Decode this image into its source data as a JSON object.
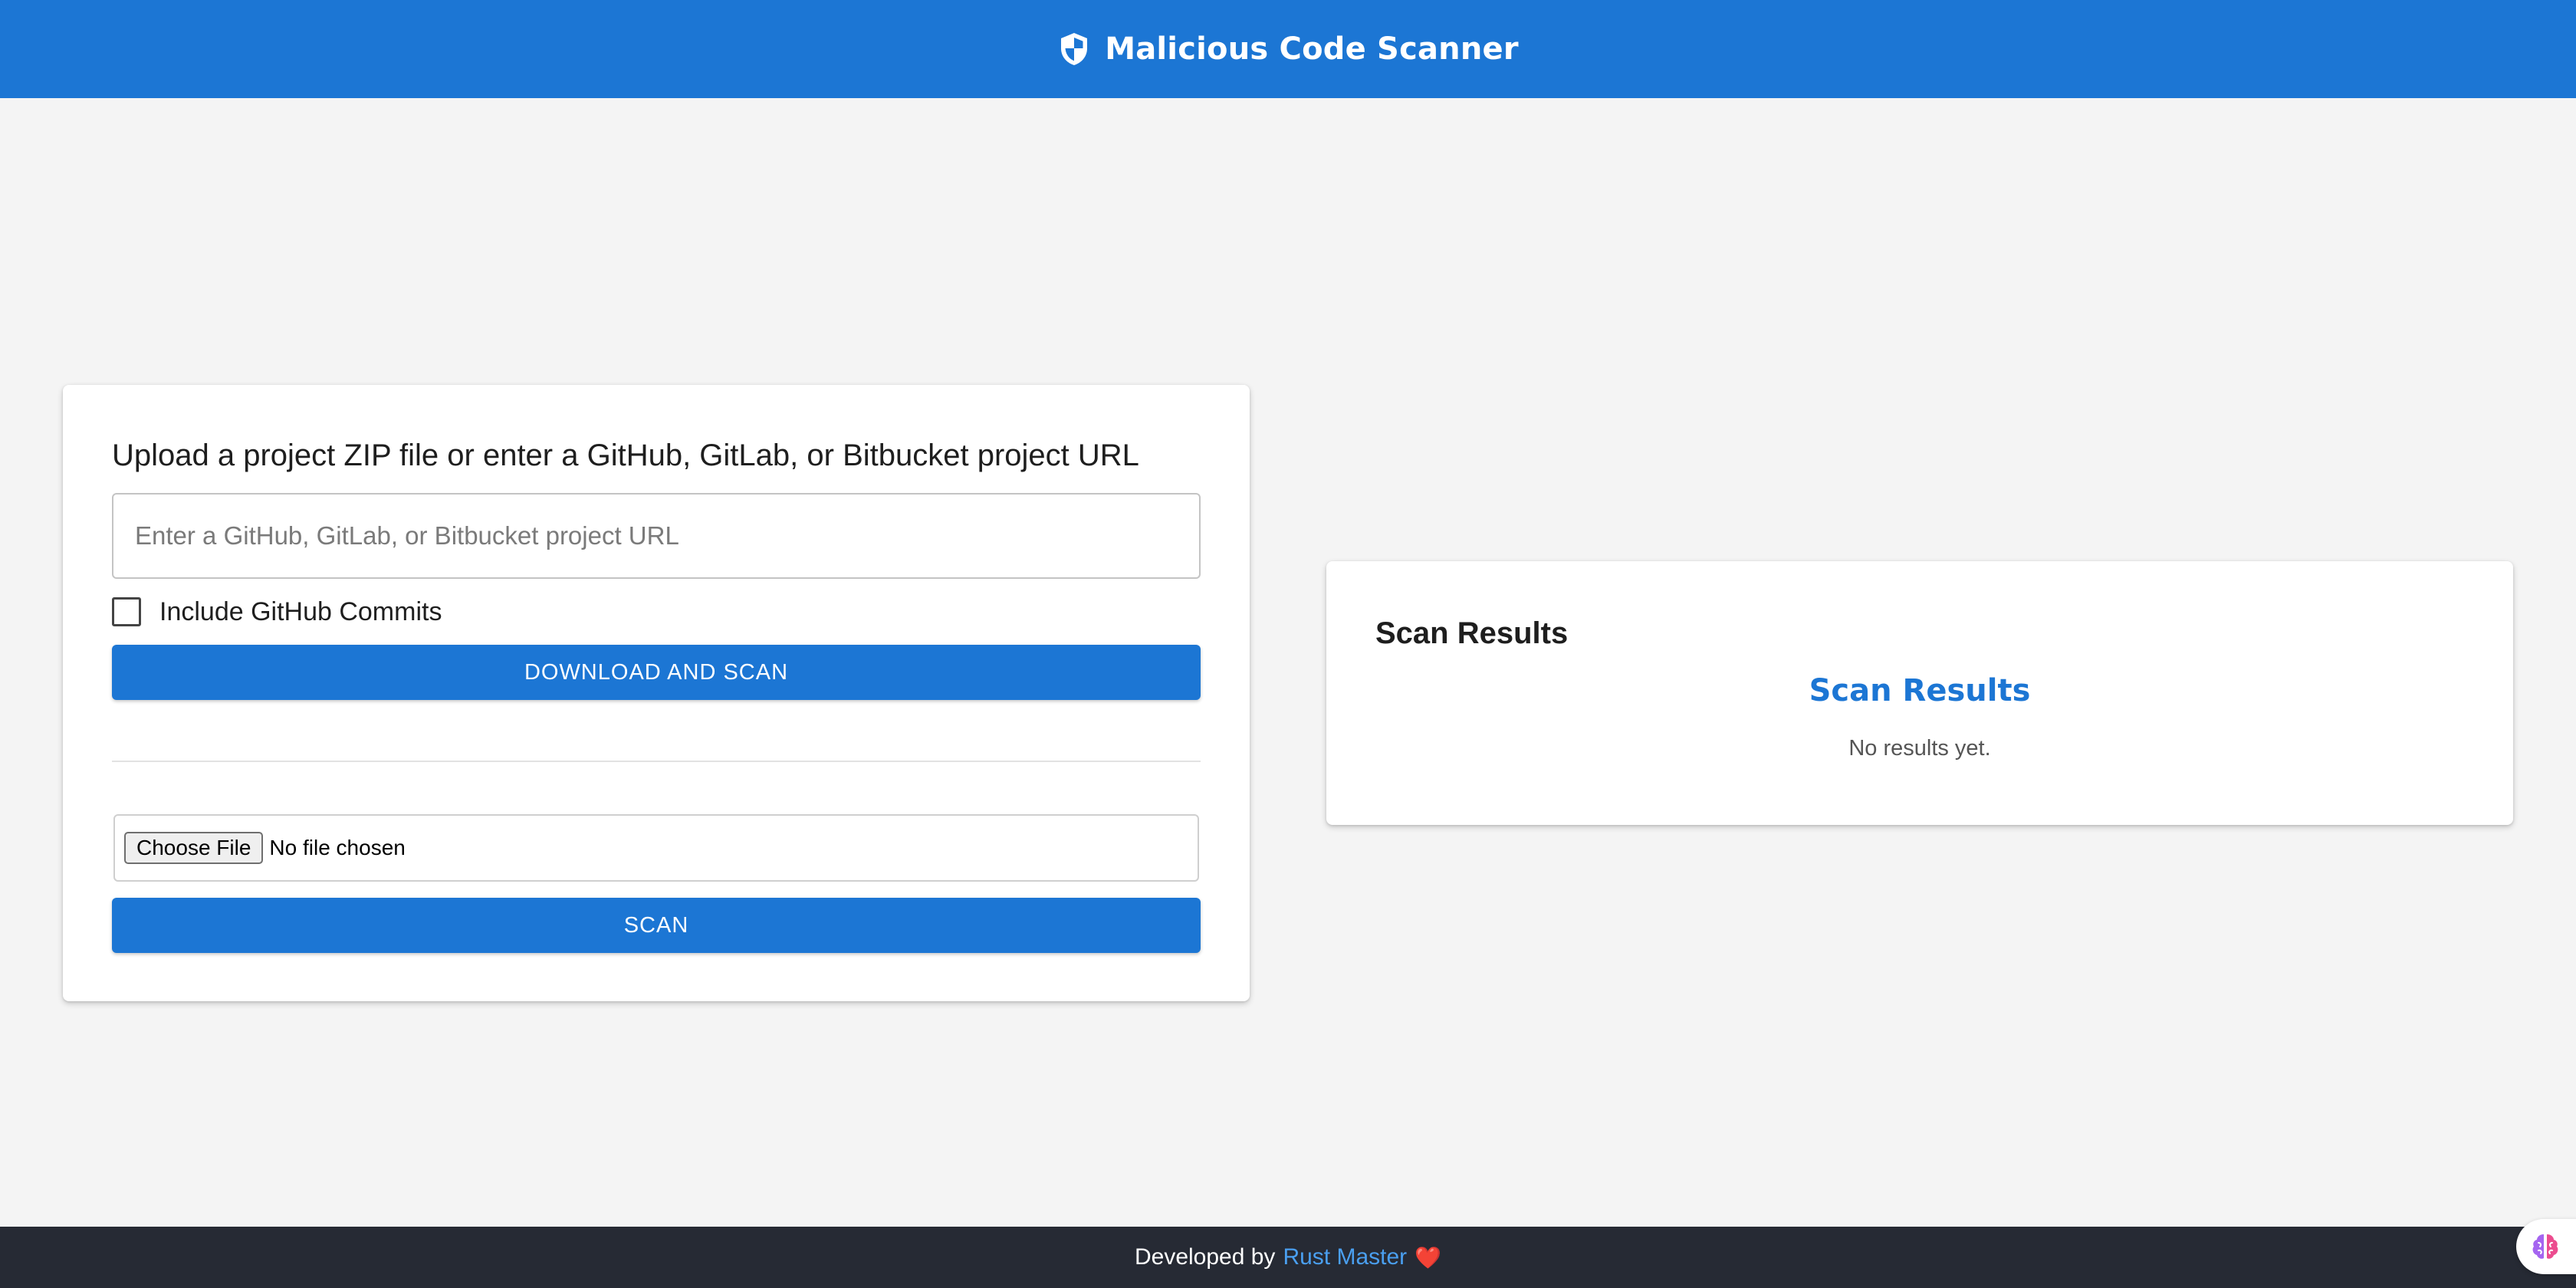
{
  "header": {
    "title": "Malicious Code Scanner",
    "icon": "shield-icon",
    "background": "#1c76d4"
  },
  "upload": {
    "heading": "Upload a project ZIP file or enter a GitHub, GitLab, or Bitbucket project URL",
    "url_placeholder": "Enter a GitHub, GitLab, or Bitbucket project URL",
    "url_value": "",
    "include_commits_label": "Include GitHub Commits",
    "include_commits_checked": false,
    "download_button": "DOWNLOAD AND SCAN",
    "choose_file_button": "Choose File",
    "file_status": "No file chosen",
    "scan_button": "SCAN"
  },
  "results": {
    "heading": "Scan Results",
    "subheading": "Scan Results",
    "empty_message": "No results yet."
  },
  "footer": {
    "prefix": "Developed by",
    "author": "Rust Master",
    "heart": "❤️",
    "background": "#262a34"
  },
  "widget": {
    "icon": "brain-icon"
  },
  "colors": {
    "primary": "#1c76d4",
    "page_background": "#f4f4f4",
    "link": "#4a9ff0"
  }
}
